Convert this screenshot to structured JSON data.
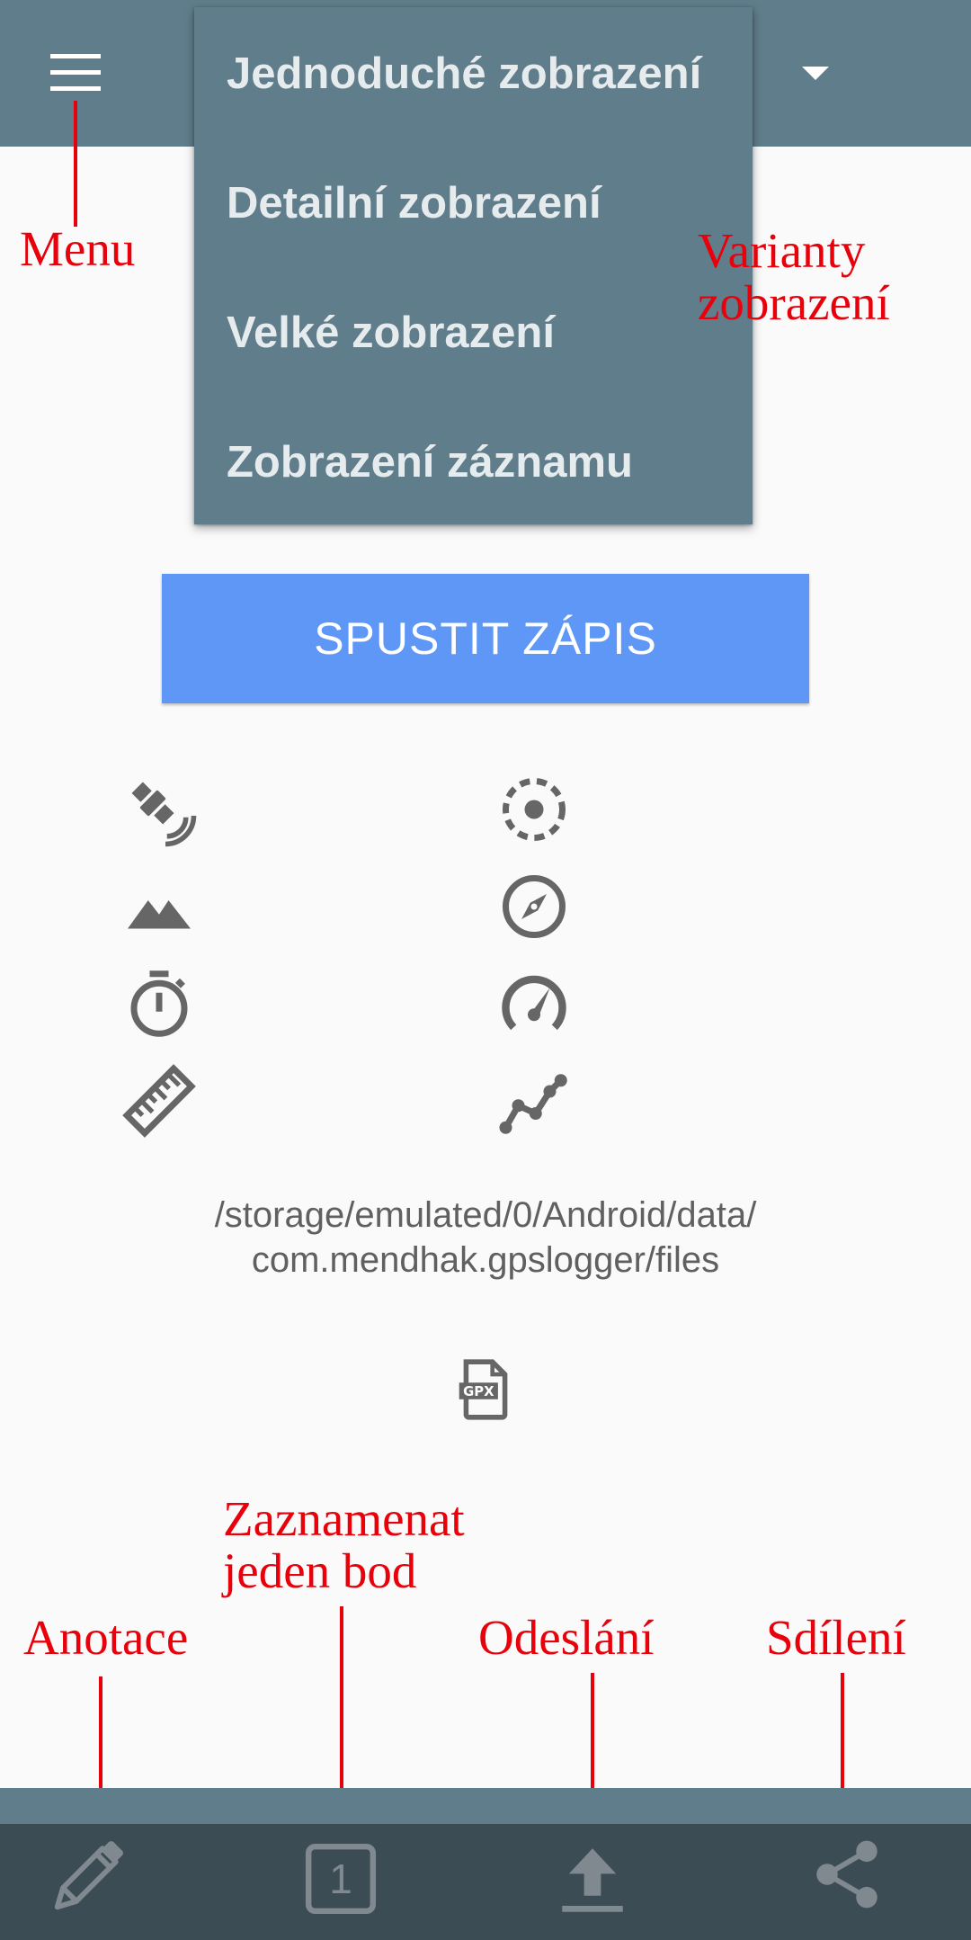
{
  "toolbar": {
    "menu_icon": "hamburger-menu-icon",
    "dropdown_icon": "dropdown-arrow-icon"
  },
  "view_menu": {
    "items": [
      {
        "label": "Jednoduché zobrazení"
      },
      {
        "label": "Detailní zobrazení"
      },
      {
        "label": "Velké zobrazení"
      },
      {
        "label": "Zobrazení záznamu"
      }
    ]
  },
  "main": {
    "start_button_label": "SPUSTIT ZÁPIS",
    "stats_icons": [
      "satellite-icon",
      "accuracy-icon",
      "altitude-icon",
      "compass-icon",
      "timer-icon",
      "speed-icon",
      "distance-icon",
      "track-points-icon"
    ],
    "storage_path_line1": "/storage/emulated/0/Android/data/",
    "storage_path_line2": "com.mendhak.gpslogger/files",
    "file_type_icon": "gpx-file-icon"
  },
  "annotations": {
    "menu": "Menu",
    "view_variants_line1": "Varianty",
    "view_variants_line2": "zobrazení",
    "single_point_line1": "Zaznamenat",
    "single_point_line2": "jeden bod",
    "annotation": "Anotace",
    "upload": "Odeslání",
    "share": "Sdílení"
  },
  "bottom_bar": {
    "icons": [
      "pencil-icon",
      "single-point-icon",
      "upload-icon",
      "share-icon"
    ],
    "single_point_number": "1"
  },
  "colors": {
    "primary": "#607d8b",
    "bottom_bar": "#3b4c55",
    "button": "#5e97f6",
    "annotation_red": "#e8000b",
    "icon_gray": "#666666"
  }
}
